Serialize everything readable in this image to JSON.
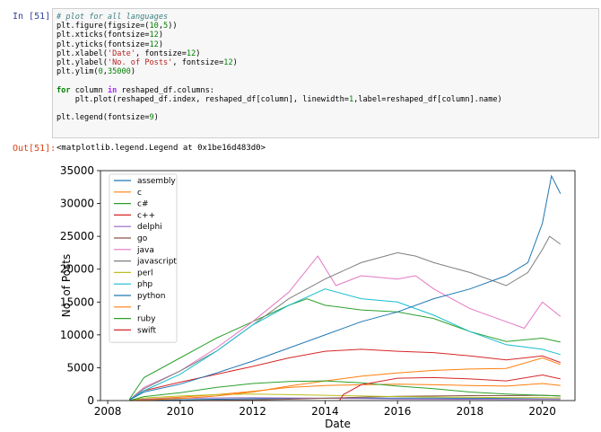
{
  "input_prompt": "In [51]:",
  "output_prompt": "Out[51]:",
  "output_text": "<matplotlib.legend.Legend at 0x1be16d483d0>",
  "code_lines": [
    [
      {
        "t": "# plot for all languages",
        "c": "cm"
      }
    ],
    [
      {
        "t": "plt.figure(figsize=("
      },
      {
        "t": "10",
        "c": "num"
      },
      {
        "t": ","
      },
      {
        "t": "5",
        "c": "num"
      },
      {
        "t": "))"
      }
    ],
    [
      {
        "t": "plt.xticks(fontsize="
      },
      {
        "t": "12",
        "c": "num"
      },
      {
        "t": ")"
      }
    ],
    [
      {
        "t": "plt.yticks(fontsize="
      },
      {
        "t": "12",
        "c": "num"
      },
      {
        "t": ")"
      }
    ],
    [
      {
        "t": "plt.xlabel("
      },
      {
        "t": "'Date'",
        "c": "str"
      },
      {
        "t": ", fontsize="
      },
      {
        "t": "12",
        "c": "num"
      },
      {
        "t": ")"
      }
    ],
    [
      {
        "t": "plt.ylabel("
      },
      {
        "t": "'No. of Posts'",
        "c": "str"
      },
      {
        "t": ", fontsize="
      },
      {
        "t": "12",
        "c": "num"
      },
      {
        "t": ")"
      }
    ],
    [
      {
        "t": "plt.ylim("
      },
      {
        "t": "0",
        "c": "num"
      },
      {
        "t": ","
      },
      {
        "t": "35000",
        "c": "num"
      },
      {
        "t": ")"
      }
    ],
    [],
    [
      {
        "t": "for",
        "c": "kw"
      },
      {
        "t": " column "
      },
      {
        "t": "in",
        "c": "op"
      },
      {
        "t": " reshaped_df.columns:"
      }
    ],
    [
      {
        "t": "    plt.plot(reshaped_df.index, reshaped_df[column], linewidth="
      },
      {
        "t": "1",
        "c": "num"
      },
      {
        "t": ",label=reshaped_df[column].name)"
      }
    ],
    [],
    [
      {
        "t": "plt.legend(fontsize="
      },
      {
        "t": "9",
        "c": "num"
      },
      {
        "t": ")"
      }
    ]
  ],
  "chart_data": {
    "type": "line",
    "xlabel": "Date",
    "ylabel": "No. of Posts",
    "xlim": [
      2007.8,
      2020.9
    ],
    "ylim": [
      0,
      35000
    ],
    "xticks": [
      2008,
      2010,
      2012,
      2014,
      2016,
      2018,
      2020
    ],
    "yticks": [
      0,
      5000,
      10000,
      15000,
      20000,
      25000,
      30000,
      35000
    ],
    "legend_position": "upper-left",
    "series": [
      {
        "name": "assembly",
        "color": "#1f77b4",
        "points": [
          [
            2008.6,
            0
          ],
          [
            2009,
            30
          ],
          [
            2010,
            120
          ],
          [
            2011,
            200
          ],
          [
            2012,
            280
          ],
          [
            2013,
            330
          ],
          [
            2014,
            350
          ],
          [
            2015,
            380
          ],
          [
            2016,
            380
          ],
          [
            2017,
            370
          ],
          [
            2018,
            350
          ],
          [
            2019,
            340
          ],
          [
            2020,
            400
          ],
          [
            2020.5,
            380
          ]
        ]
      },
      {
        "name": "c",
        "color": "#ff7f0e",
        "points": [
          [
            2008.6,
            0
          ],
          [
            2009,
            200
          ],
          [
            2010,
            500
          ],
          [
            2011,
            900
          ],
          [
            2012,
            1400
          ],
          [
            2013,
            2000
          ],
          [
            2014,
            2300
          ],
          [
            2015,
            2400
          ],
          [
            2016,
            2500
          ],
          [
            2017,
            2400
          ],
          [
            2018,
            2300
          ],
          [
            2019,
            2200
          ],
          [
            2020,
            2600
          ],
          [
            2020.5,
            2300
          ]
        ]
      },
      {
        "name": "c#",
        "color": "#2ca02c",
        "points": [
          [
            2008.6,
            200
          ],
          [
            2009,
            3500
          ],
          [
            2010,
            6500
          ],
          [
            2011,
            9500
          ],
          [
            2012,
            12000
          ],
          [
            2013,
            14500
          ],
          [
            2013.5,
            15500
          ],
          [
            2014,
            14500
          ],
          [
            2015,
            13800
          ],
          [
            2016,
            13500
          ],
          [
            2017,
            12500
          ],
          [
            2018,
            10500
          ],
          [
            2019,
            9000
          ],
          [
            2020,
            9500
          ],
          [
            2020.5,
            8900
          ]
        ]
      },
      {
        "name": "c++",
        "color": "#d62728",
        "points": [
          [
            2008.6,
            100
          ],
          [
            2009,
            1500
          ],
          [
            2010,
            2800
          ],
          [
            2011,
            4000
          ],
          [
            2012,
            5200
          ],
          [
            2013,
            6500
          ],
          [
            2014,
            7500
          ],
          [
            2015,
            7800
          ],
          [
            2016,
            7500
          ],
          [
            2017,
            7300
          ],
          [
            2018,
            6800
          ],
          [
            2019,
            6200
          ],
          [
            2020,
            6800
          ],
          [
            2020.5,
            5800
          ]
        ]
      },
      {
        "name": "delphi",
        "color": "#9467bd",
        "points": [
          [
            2008.6,
            0
          ],
          [
            2009,
            200
          ],
          [
            2010,
            350
          ],
          [
            2011,
            400
          ],
          [
            2012,
            420
          ],
          [
            2013,
            400
          ],
          [
            2014,
            350
          ],
          [
            2015,
            300
          ],
          [
            2016,
            250
          ],
          [
            2017,
            220
          ],
          [
            2018,
            200
          ],
          [
            2019,
            180
          ],
          [
            2020,
            190
          ],
          [
            2020.5,
            170
          ]
        ]
      },
      {
        "name": "go",
        "color": "#8c564b",
        "points": [
          [
            2008.6,
            0
          ],
          [
            2010,
            0
          ],
          [
            2011,
            50
          ],
          [
            2012,
            100
          ],
          [
            2013,
            200
          ],
          [
            2014,
            350
          ],
          [
            2015,
            500
          ],
          [
            2016,
            650
          ],
          [
            2017,
            700
          ],
          [
            2018,
            750
          ],
          [
            2019,
            750
          ],
          [
            2020,
            800
          ],
          [
            2020.5,
            700
          ]
        ]
      },
      {
        "name": "java",
        "color": "#e377c2",
        "points": [
          [
            2008.6,
            100
          ],
          [
            2009,
            2000
          ],
          [
            2010,
            4500
          ],
          [
            2011,
            8000
          ],
          [
            2012,
            12000
          ],
          [
            2013,
            16500
          ],
          [
            2013.8,
            22000
          ],
          [
            2014.3,
            17500
          ],
          [
            2015,
            19000
          ],
          [
            2016,
            18500
          ],
          [
            2016.5,
            19000
          ],
          [
            2017,
            17000
          ],
          [
            2018,
            14000
          ],
          [
            2019,
            12000
          ],
          [
            2019.5,
            11000
          ],
          [
            2020,
            15000
          ],
          [
            2020.5,
            12800
          ]
        ]
      },
      {
        "name": "javascript",
        "color": "#7f7f7f",
        "points": [
          [
            2008.6,
            100
          ],
          [
            2009,
            1800
          ],
          [
            2010,
            4500
          ],
          [
            2011,
            7500
          ],
          [
            2012,
            11500
          ],
          [
            2013,
            15500
          ],
          [
            2014,
            18500
          ],
          [
            2015,
            21000
          ],
          [
            2016,
            22500
          ],
          [
            2016.5,
            22000
          ],
          [
            2017,
            21000
          ],
          [
            2018,
            19500
          ],
          [
            2019,
            17500
          ],
          [
            2019.6,
            19500
          ],
          [
            2020,
            23000
          ],
          [
            2020.2,
            25000
          ],
          [
            2020.5,
            23800
          ]
        ]
      },
      {
        "name": "perl",
        "color": "#bcbd22",
        "points": [
          [
            2008.6,
            0
          ],
          [
            2009,
            400
          ],
          [
            2010,
            700
          ],
          [
            2011,
            900
          ],
          [
            2012,
            1000
          ],
          [
            2013,
            900
          ],
          [
            2014,
            800
          ],
          [
            2015,
            700
          ],
          [
            2016,
            600
          ],
          [
            2017,
            550
          ],
          [
            2018,
            500
          ],
          [
            2019,
            450
          ],
          [
            2020,
            450
          ],
          [
            2020.5,
            400
          ]
        ]
      },
      {
        "name": "php",
        "color": "#17becf",
        "points": [
          [
            2008.6,
            100
          ],
          [
            2009,
            1500
          ],
          [
            2010,
            4000
          ],
          [
            2011,
            7500
          ],
          [
            2012,
            11500
          ],
          [
            2013,
            14500
          ],
          [
            2014,
            17000
          ],
          [
            2015,
            15500
          ],
          [
            2016,
            15000
          ],
          [
            2016.5,
            14000
          ],
          [
            2017,
            13000
          ],
          [
            2018,
            10500
          ],
          [
            2019,
            8500
          ],
          [
            2020,
            7800
          ],
          [
            2020.5,
            7000
          ]
        ]
      },
      {
        "name": "python",
        "color": "#1f77b4",
        "points": [
          [
            2008.6,
            100
          ],
          [
            2009,
            1300
          ],
          [
            2010,
            2500
          ],
          [
            2011,
            4200
          ],
          [
            2012,
            6000
          ],
          [
            2013,
            8000
          ],
          [
            2014,
            10000
          ],
          [
            2015,
            12000
          ],
          [
            2016,
            13500
          ],
          [
            2017,
            15500
          ],
          [
            2018,
            17000
          ],
          [
            2019,
            19000
          ],
          [
            2019.6,
            21000
          ],
          [
            2020,
            27000
          ],
          [
            2020.25,
            34200
          ],
          [
            2020.5,
            31500
          ]
        ]
      },
      {
        "name": "r",
        "color": "#ff7f0e",
        "points": [
          [
            2008.6,
            0
          ],
          [
            2009,
            100
          ],
          [
            2010,
            300
          ],
          [
            2011,
            700
          ],
          [
            2012,
            1300
          ],
          [
            2013,
            2200
          ],
          [
            2014,
            3000
          ],
          [
            2015,
            3700
          ],
          [
            2016,
            4200
          ],
          [
            2017,
            4600
          ],
          [
            2018,
            4800
          ],
          [
            2019,
            4900
          ],
          [
            2020,
            6500
          ],
          [
            2020.5,
            5500
          ]
        ]
      },
      {
        "name": "ruby",
        "color": "#2ca02c",
        "points": [
          [
            2008.6,
            0
          ],
          [
            2009,
            600
          ],
          [
            2010,
            1200
          ],
          [
            2011,
            2000
          ],
          [
            2012,
            2600
          ],
          [
            2013,
            2900
          ],
          [
            2014,
            3000
          ],
          [
            2015,
            2700
          ],
          [
            2016,
            2200
          ],
          [
            2017,
            1800
          ],
          [
            2018,
            1300
          ],
          [
            2019,
            1000
          ],
          [
            2020,
            800
          ],
          [
            2020.5,
            700
          ]
        ]
      },
      {
        "name": "swift",
        "color": "#d62728",
        "points": [
          [
            2014.4,
            0
          ],
          [
            2014.5,
            900
          ],
          [
            2015,
            2400
          ],
          [
            2016,
            3400
          ],
          [
            2017,
            3500
          ],
          [
            2018,
            3300
          ],
          [
            2019,
            3000
          ],
          [
            2020,
            3900
          ],
          [
            2020.5,
            3300
          ]
        ]
      }
    ]
  }
}
